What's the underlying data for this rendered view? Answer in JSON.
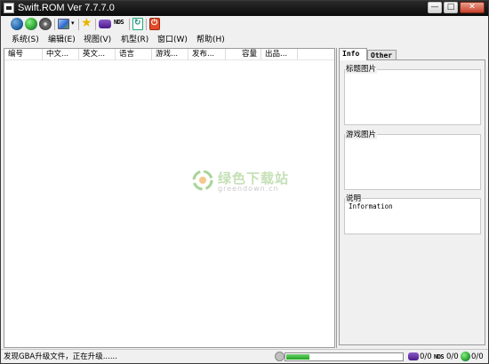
{
  "window": {
    "title": "Swift.ROM Ver 7.7.7.0",
    "controls": {
      "minimize": "—",
      "maximize": "□",
      "close": "✕"
    }
  },
  "toolbar": {
    "icons": [
      "globe-icon",
      "world-icon",
      "disc-icon",
      "image-icon",
      "dropdown-arrow-icon",
      "star-icon",
      "gba-icon",
      "nds-icon",
      "refresh-icon",
      "power-icon"
    ],
    "nds_label": "NDS"
  },
  "menu": [
    "系统(S)",
    "编辑(E)",
    "视图(V)",
    "机型(R)",
    "窗口(W)",
    "帮助(H)"
  ],
  "list": {
    "columns": [
      "编号",
      "中文...",
      "英文...",
      "语言",
      "游戏...",
      "发布...",
      "容量",
      "出品..."
    ]
  },
  "watermark": {
    "text": "绿色下载站",
    "sub": "greendown.cn"
  },
  "side_panel": {
    "tabs": [
      "Info",
      "Other"
    ],
    "active_tab": "Info",
    "title_image_label": "标题图片",
    "game_image_label": "游戏图片",
    "description_label": "说明",
    "description_text": "Information"
  },
  "status": {
    "message": "发现GBA升级文件，正在升级......",
    "progress": 0.2,
    "gba_count": "0/0",
    "nds_label": "NDS",
    "nds_count": "0/0",
    "net_count": "0/0"
  },
  "colors": {
    "titlebar": "#111111",
    "progress": "#1ea31e",
    "watermark": "#7bbf5a"
  }
}
